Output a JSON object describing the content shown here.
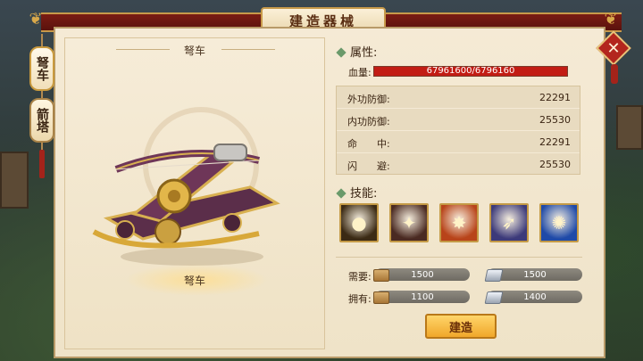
{
  "window": {
    "title": "建造器械",
    "close_icon": "close-icon"
  },
  "tabs": [
    {
      "label": "弩车",
      "active": true
    },
    {
      "label": "箭塔",
      "active": false
    }
  ],
  "unit": {
    "name": "弩车",
    "name_bottom": "弩车"
  },
  "attributes": {
    "section_title": "属性:",
    "hp_label": "血量:",
    "hp_text": "67961600/6796160",
    "hp_fraction": 1.0,
    "hp_color": "#c21c14",
    "stats": [
      {
        "label": "外功防御:",
        "value": "22291"
      },
      {
        "label": "内功防御:",
        "value": "25530"
      },
      {
        "label": "命　　中:",
        "value": "22291"
      },
      {
        "label": "闪　　避:",
        "value": "25530"
      }
    ]
  },
  "skills": {
    "section_title": "技能:",
    "items": [
      {
        "icon": "gold-orb-icon",
        "color": "#3b2a14"
      },
      {
        "icon": "blade-strike-icon",
        "color": "#4a2a22"
      },
      {
        "icon": "fire-slash-icon",
        "color": "#b8441a"
      },
      {
        "icon": "shadow-leap-icon",
        "color": "#3c3a7a"
      },
      {
        "icon": "ice-burst-icon",
        "color": "#1f4aa8"
      }
    ]
  },
  "resources": {
    "need_label": "需要:",
    "have_label": "拥有:",
    "need": {
      "wood": "1500",
      "ore": "1500"
    },
    "have": {
      "wood": "1100",
      "ore": "1400"
    }
  },
  "build_button": "建造"
}
